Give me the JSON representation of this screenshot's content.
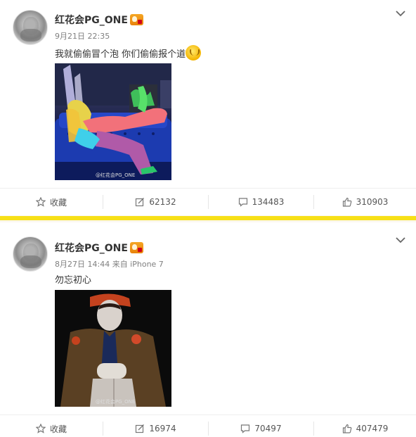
{
  "posts": [
    {
      "username": "红花会PG_ONE",
      "date": "9月21日 22:35",
      "source": "",
      "text": "我就偷偷冒个泡 你们偷偷报个道",
      "watermark": "@红花会PG_ONE",
      "actions": {
        "favorite": "收藏",
        "repost": "62132",
        "comment": "134483",
        "like": "310903"
      }
    },
    {
      "username": "红花会PG_ONE",
      "date": "8月27日 14:44 来自 iPhone 7",
      "source": "",
      "text": "勿忘初心",
      "watermark": "@红花会PG_ONE",
      "actions": {
        "favorite": "收藏",
        "repost": "16974",
        "comment": "70497",
        "like": "407479"
      }
    }
  ],
  "colors": {
    "separator": "#f7e017",
    "text": "#333333",
    "meta": "#808080"
  },
  "icons": [
    "verified-badge-icon",
    "star-icon",
    "repost-icon",
    "comment-icon",
    "like-icon",
    "chevron-down-icon",
    "emoji-icon"
  ]
}
